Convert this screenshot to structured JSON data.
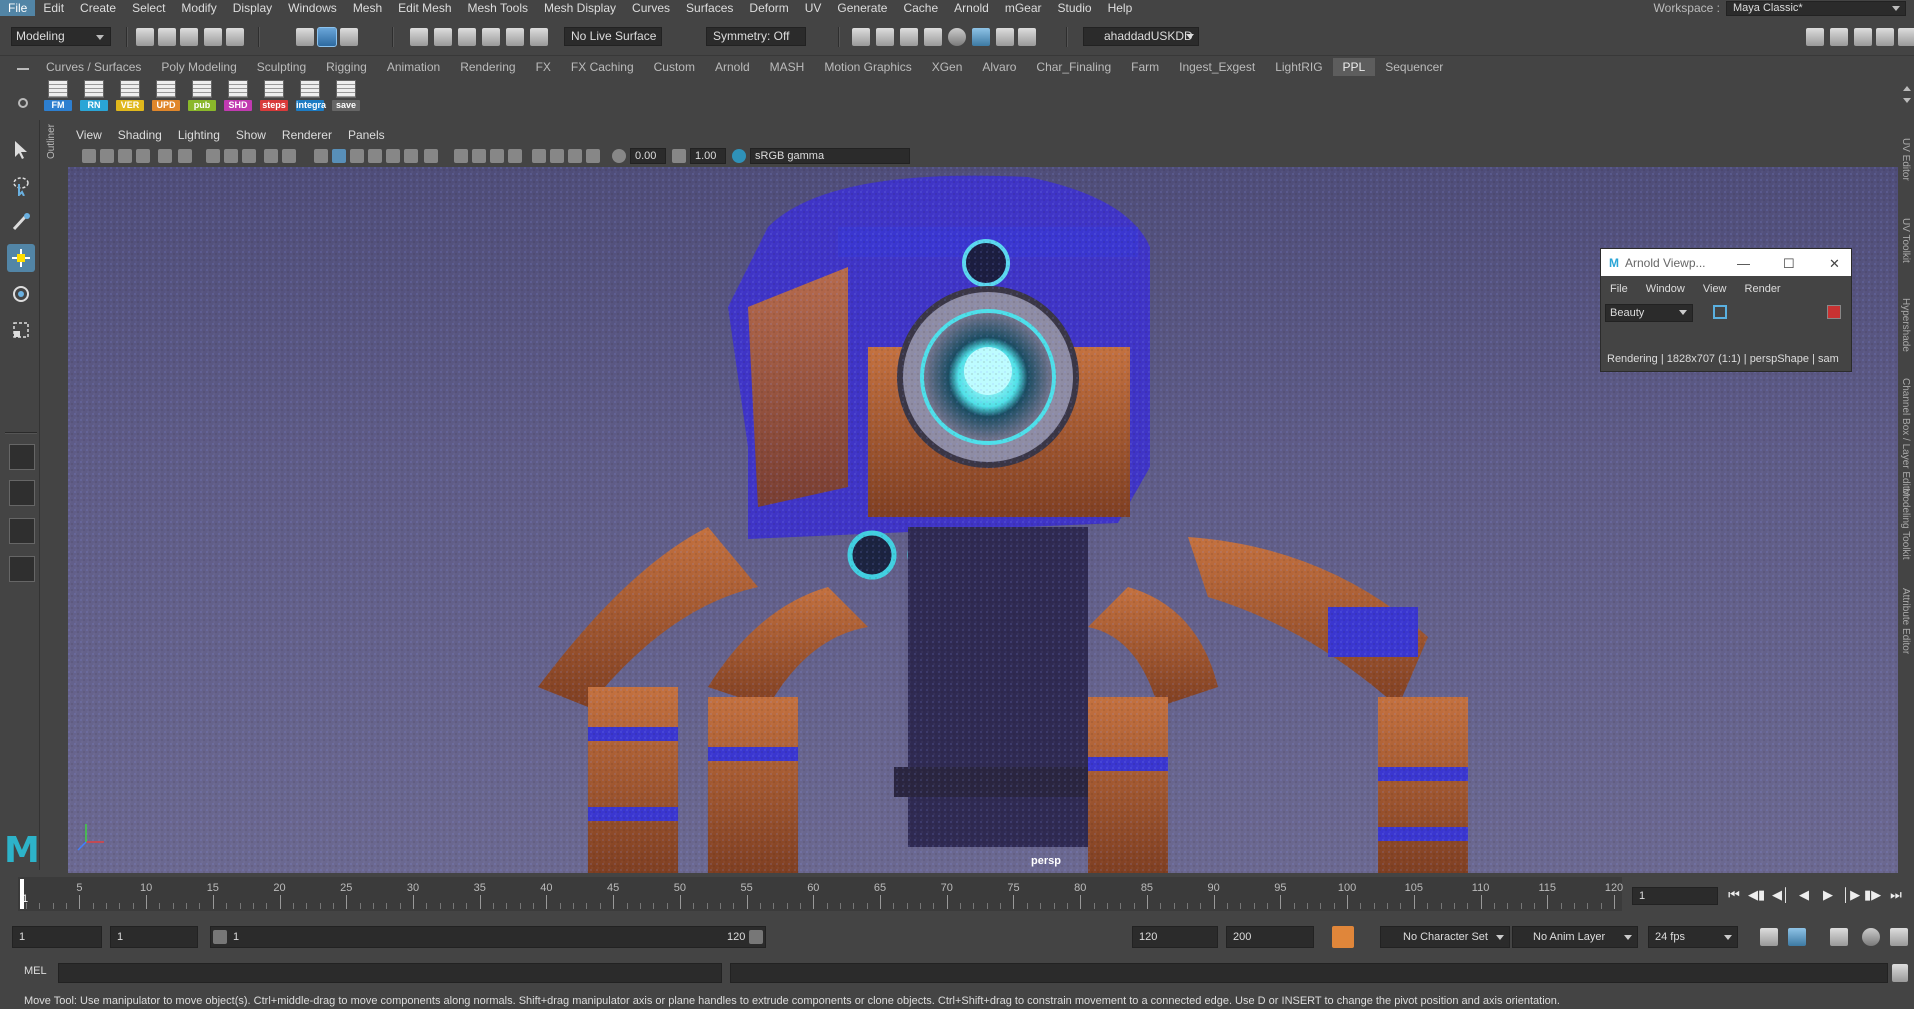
{
  "menubar": {
    "items": [
      "File",
      "Edit",
      "Create",
      "Select",
      "Modify",
      "Display",
      "Windows",
      "Mesh",
      "Edit Mesh",
      "Mesh Tools",
      "Mesh Display",
      "Curves",
      "Surfaces",
      "Deform",
      "UV",
      "Generate",
      "Cache",
      "Arnold",
      "mGear",
      "Studio",
      "Help"
    ],
    "workspace_label": "Workspace :",
    "workspace_value": "Maya Classic*"
  },
  "statusline": {
    "mode": "Modeling",
    "live_surface": "No Live Surface",
    "symmetry": "Symmetry: Off",
    "user": "ahaddadUSKDD"
  },
  "shelf": {
    "tabs": [
      "Curves / Surfaces",
      "Poly Modeling",
      "Sculpting",
      "Rigging",
      "Animation",
      "Rendering",
      "FX",
      "FX Caching",
      "Custom",
      "Arnold",
      "MASH",
      "Motion Graphics",
      "XGen",
      "Alvaro",
      "Char_Finaling",
      "Farm",
      "Ingest_Exgest",
      "LightRIG",
      "PPL",
      "Sequencer"
    ],
    "active_tab": "PPL",
    "buttons": [
      {
        "label": "FM",
        "color": "#2d7fd0"
      },
      {
        "label": "RN",
        "color": "#2aa5d6"
      },
      {
        "label": "VER",
        "color": "#e0b81c"
      },
      {
        "label": "UPD",
        "color": "#e0862a"
      },
      {
        "label": "pub",
        "color": "#8ab82a"
      },
      {
        "label": "SHD",
        "color": "#c13ab0"
      },
      {
        "label": "steps",
        "color": "#d93a3a"
      },
      {
        "label": "integra",
        "color": "#1c7cc4"
      },
      {
        "label": "save",
        "color": "#666666"
      }
    ]
  },
  "outliner": {
    "label": "Outliner"
  },
  "panel": {
    "menus": [
      "View",
      "Shading",
      "Lighting",
      "Show",
      "Renderer",
      "Panels"
    ],
    "exposure": "0.00",
    "gamma": "1.00",
    "color_space": "sRGB gamma",
    "camera_label": "persp"
  },
  "arnold": {
    "title": "Arnold Viewp...",
    "menus": [
      "File",
      "Window",
      "View",
      "Render"
    ],
    "aov": "Beauty",
    "status": "Rendering | 1828x707 (1:1) | perspShape | sam"
  },
  "right_tabs": [
    "UV Editor",
    "UV Toolkit",
    "Hypershade",
    "Channel Box / Layer Editor",
    "Modeling Toolkit",
    "Attribute Editor"
  ],
  "timeslider": {
    "ticks": [
      1,
      5,
      10,
      15,
      20,
      25,
      30,
      35,
      40,
      45,
      50,
      55,
      60,
      65,
      70,
      75,
      80,
      85,
      90,
      95,
      100,
      105,
      110,
      115,
      120
    ],
    "current_frame": "1",
    "frame_field": "1"
  },
  "rangeslider": {
    "start": "1",
    "playback_start": "1",
    "range_start": "1",
    "range_end": "120",
    "playback_end": "120",
    "end": "200",
    "character_set": "No Character Set",
    "anim_layer": "No Anim Layer",
    "fps": "24 fps"
  },
  "cmdline": {
    "label": "MEL"
  },
  "helpline": {
    "text": "Move Tool: Use manipulator to move object(s). Ctrl+middle-drag to move components along normals. Shift+drag manipulator axis or plane handles to extrude components or clone objects. Ctrl+Shift+drag to constrain movement to a connected edge. Use D or INSERT to change the pivot position and axis orientation."
  }
}
